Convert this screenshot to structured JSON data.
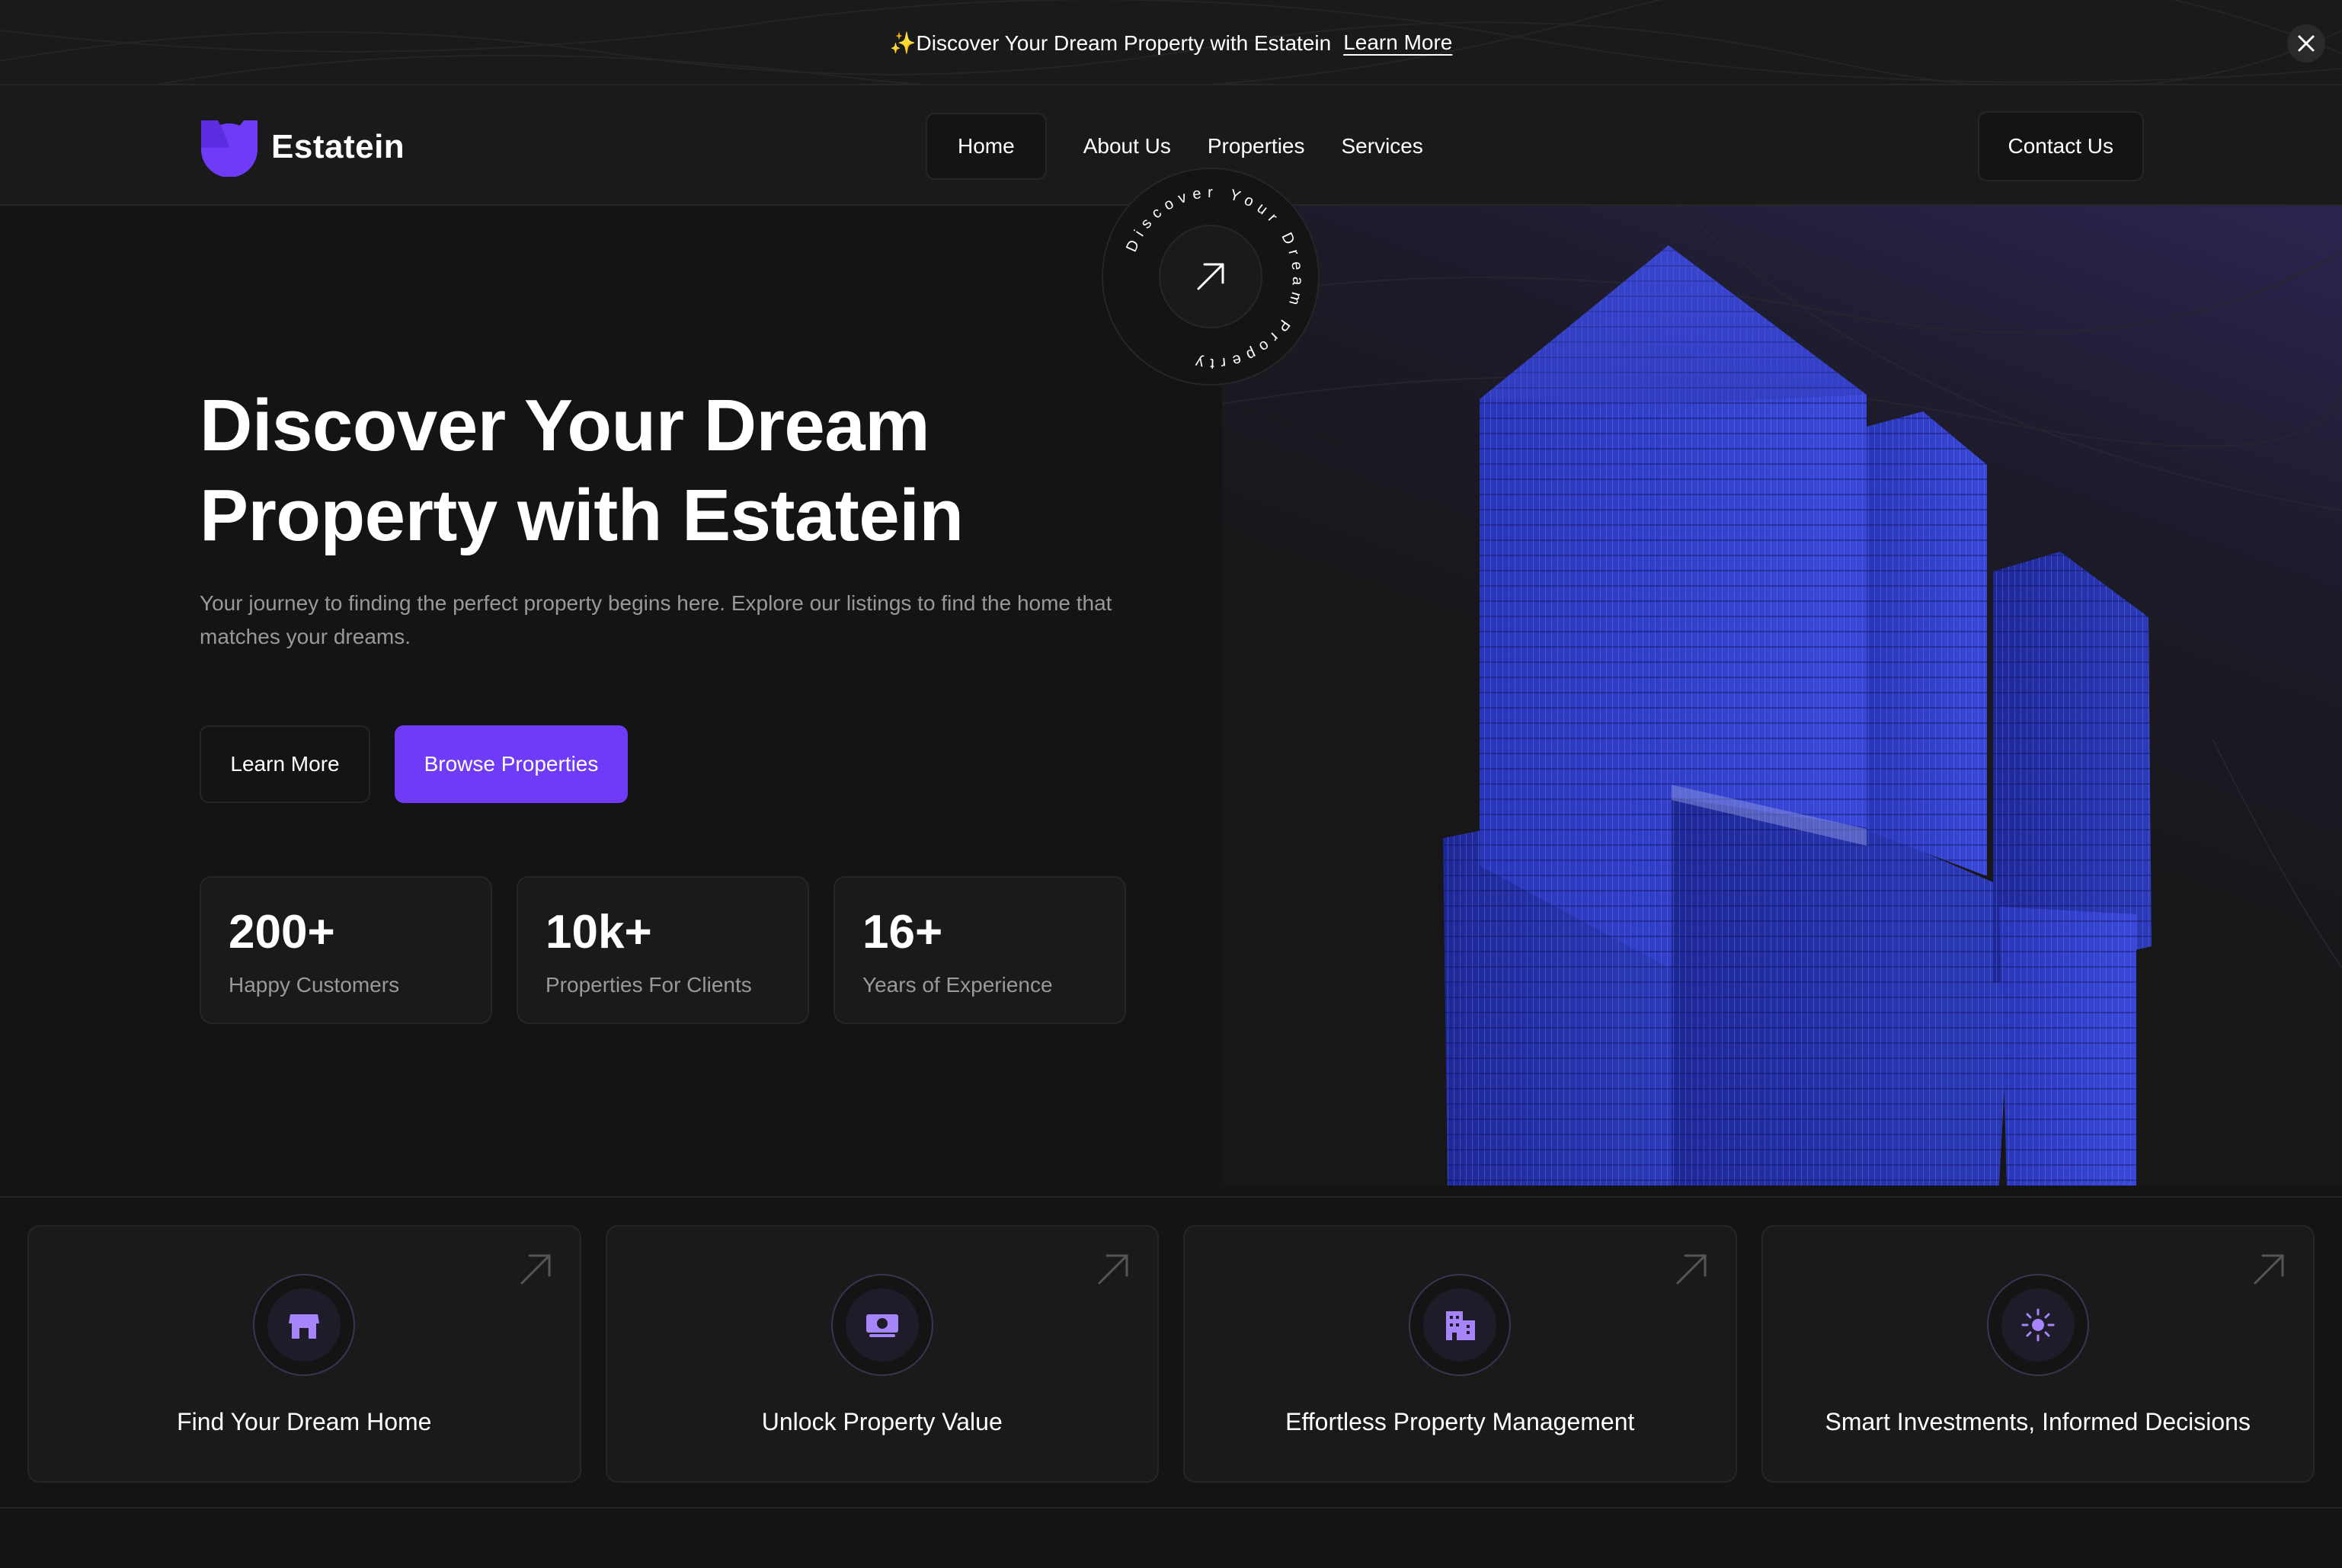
{
  "banner": {
    "spark": "✨",
    "text": "Discover Your Dream Property with Estatein",
    "link": "Learn More"
  },
  "header": {
    "logo_text": "Estatein",
    "nav": [
      {
        "label": "Home",
        "active": true
      },
      {
        "label": "About Us"
      },
      {
        "label": "Properties"
      },
      {
        "label": "Services"
      }
    ],
    "contact": "Contact Us"
  },
  "hero": {
    "title_line1": "Discover Your Dream",
    "title_line2": "Property with Estatein",
    "subtitle": "Your journey to finding the perfect property begins here. Explore our listings to find the home that matches your dreams.",
    "btn_learn": "Learn More",
    "btn_browse": "Browse Properties",
    "badge_text": "Discover Your Dream Property",
    "stats": [
      {
        "value": "200+",
        "label": "Happy Customers"
      },
      {
        "value": "10k+",
        "label": "Properties For Clients"
      },
      {
        "value": "16+",
        "label": "Years of Experience"
      }
    ]
  },
  "features": [
    {
      "label": "Find Your Dream Home",
      "icon": "storefront-icon"
    },
    {
      "label": "Unlock Property Value",
      "icon": "cash-icon"
    },
    {
      "label": "Effortless Property Management",
      "icon": "buildings-icon"
    },
    {
      "label": "Smart Investments, Informed Decisions",
      "icon": "sun-icon"
    }
  ],
  "colors": {
    "accent": "#703bf7",
    "background": "#141414",
    "panel": "#1a1a1a",
    "border": "#262626",
    "muted_text": "#999999"
  }
}
